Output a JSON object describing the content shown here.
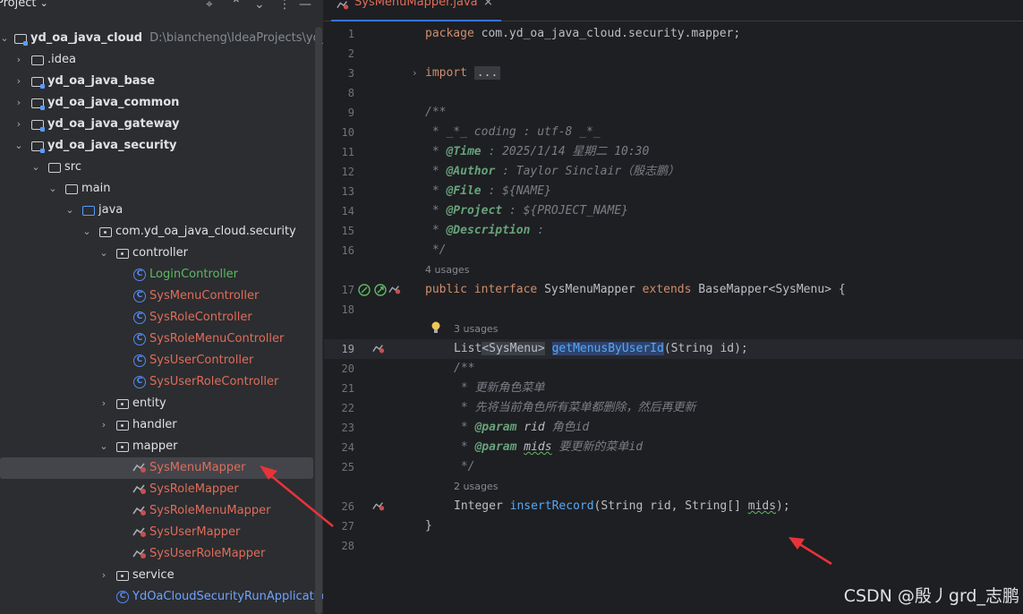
{
  "project_panel": {
    "title": "Project",
    "title_chevron": "⌄",
    "header_buttons": [
      "⌖",
      "⌃",
      "⌄",
      "⋮",
      "—"
    ],
    "root": {
      "label": "yd_oa_java_cloud",
      "path": "D:\\biancheng\\IdeaProjects\\yd_oa_"
    },
    "tree": [
      {
        "label": ".idea",
        "kind": "folder"
      },
      {
        "label": "yd_oa_java_base",
        "kind": "module"
      },
      {
        "label": "yd_oa_java_common",
        "kind": "module"
      },
      {
        "label": "yd_oa_java_gateway",
        "kind": "module"
      },
      {
        "label": "yd_oa_java_security",
        "kind": "module"
      },
      {
        "label": "src",
        "kind": "folder"
      },
      {
        "label": "main",
        "kind": "folder"
      },
      {
        "label": "java",
        "kind": "src"
      },
      {
        "label": "com.yd_oa_java_cloud.security",
        "kind": "package"
      },
      {
        "label": "controller",
        "kind": "package"
      },
      {
        "label": "LoginController",
        "kind": "class"
      },
      {
        "label": "SysMenuController",
        "kind": "class"
      },
      {
        "label": "SysRoleController",
        "kind": "class"
      },
      {
        "label": "SysRoleMenuController",
        "kind": "class"
      },
      {
        "label": "SysUserController",
        "kind": "class"
      },
      {
        "label": "SysUserRoleController",
        "kind": "class"
      },
      {
        "label": "entity",
        "kind": "package"
      },
      {
        "label": "handler",
        "kind": "package"
      },
      {
        "label": "mapper",
        "kind": "package"
      },
      {
        "label": "SysMenuMapper",
        "kind": "mapper"
      },
      {
        "label": "SysRoleMapper",
        "kind": "mapper"
      },
      {
        "label": "SysRoleMenuMapper",
        "kind": "mapper"
      },
      {
        "label": "SysUserMapper",
        "kind": "mapper"
      },
      {
        "label": "SysUserRoleMapper",
        "kind": "mapper"
      },
      {
        "label": "service",
        "kind": "package"
      },
      {
        "label": "YdOaCloudSecurityRunApplication",
        "kind": "class"
      }
    ],
    "selected_item": "SysMenuMapper"
  },
  "editor": {
    "tab": {
      "label": "SysMenuMapper.java",
      "close": "×"
    },
    "lines": {
      "l1": "1",
      "l2": "2",
      "l3": "3",
      "l8": "8",
      "l9": "9",
      "l10": "10",
      "l11": "11",
      "l12": "12",
      "l13": "13",
      "l14": "14",
      "l15": "15",
      "l16": "16",
      "l17": "17",
      "l18": "18",
      "l19": "19",
      "l20": "20",
      "l21": "21",
      "l22": "22",
      "l23": "23",
      "l24": "24",
      "l25": "25",
      "l26": "26",
      "l27": "27",
      "l28": "28"
    },
    "code": {
      "package_kw": "package",
      "package_name": " com.yd_oa_java_cloud.security.mapper;",
      "import_kw": "import",
      "import_fold": "...",
      "c_open": "/**",
      "c_coding": " * _*_ coding : utf-8 _*_",
      "c_time_tag": "@Time",
      "c_time_val": " : 2025/1/14 星期二 10:30",
      "c_author_tag": "@Author",
      "c_author_val": " : Taylor Sinclair（殷志鹏）",
      "c_file_tag": "@File",
      "c_file_val": " : ${NAME}",
      "c_project_tag": "@Project",
      "c_project_val": " : ${PROJECT_NAME}",
      "c_desc_tag": "@Description",
      "c_desc_val": " :",
      "c_close": " */",
      "usages_interface": "4 usages",
      "iface_public": "public ",
      "iface_interface": "interface ",
      "iface_name": "SysMenuMapper ",
      "iface_extends": "extends ",
      "iface_base": "BaseMapper<SysMenu> {",
      "usages_method1": "3 usages",
      "m1_type": "List",
      "m1_generic": "<SysMenu>",
      "m1_name": "getMenusByUserId",
      "m1_params": "(String id);",
      "c2_open": "/**",
      "c2_line1": " * 更新角色菜单",
      "c2_line2": " * 先将当前角色所有菜单都删除，然后再更新",
      "c2_param_tag": "@param",
      "c2_param1_name": " rid",
      "c2_param1_desc": " 角色id",
      "c2_param2_name": "mids",
      "c2_param2_desc": " 要更新的菜单id",
      "c2_close": " */",
      "usages_method2": "2 usages",
      "m2_type": "Integer ",
      "m2_name": "insertRecord",
      "m2_params_a": "(String rid, String[] ",
      "m2_params_b": "mids",
      "m2_params_c": ");",
      "close_brace": "}"
    }
  },
  "watermark": "CSDN @殷丿grd_志鹏",
  "colors": {
    "accent": "#3574f0",
    "annotation_arrow": "#e8333a",
    "vcs_modified": "#e06c5a"
  }
}
